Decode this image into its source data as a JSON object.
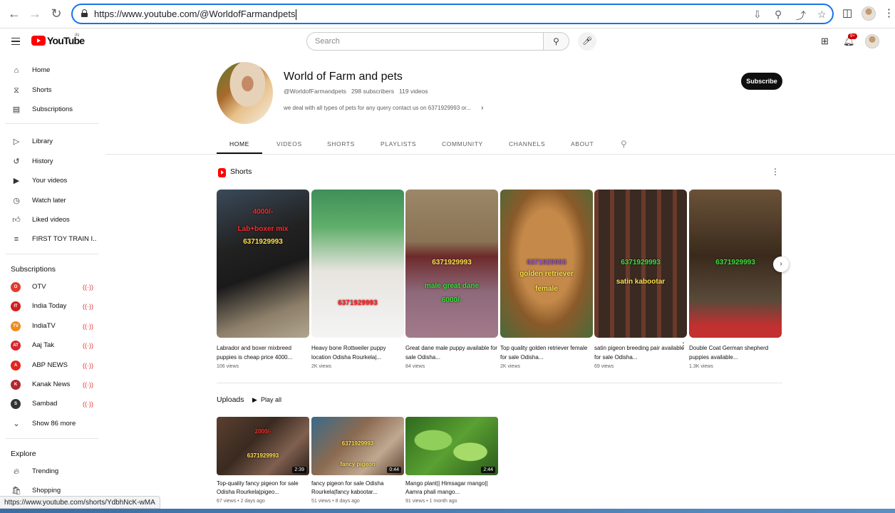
{
  "browser": {
    "url": "https://www.youtube.com/@WorldofFarmandpets",
    "status_url": "https://www.youtube.com/shorts/YdbhNcK-wMA"
  },
  "header": {
    "logo_text": "YouTube",
    "logo_region": "IN",
    "search_placeholder": "Search",
    "notification_count": "9+"
  },
  "sidebar": {
    "main": [
      {
        "label": "Home",
        "icon": "home-icon"
      },
      {
        "label": "Shorts",
        "icon": "shorts-icon"
      },
      {
        "label": "Subscriptions",
        "icon": "subscriptions-icon"
      }
    ],
    "library": [
      {
        "label": "Library",
        "icon": "library-icon"
      },
      {
        "label": "History",
        "icon": "history-icon"
      },
      {
        "label": "Your videos",
        "icon": "your-videos-icon"
      },
      {
        "label": "Watch later",
        "icon": "watch-later-icon"
      },
      {
        "label": "Liked videos",
        "icon": "liked-videos-icon"
      },
      {
        "label": "FIRST TOY TRAIN I...",
        "icon": "playlist-icon"
      }
    ],
    "subscriptions_heading": "Subscriptions",
    "subscriptions": [
      {
        "label": "OTV",
        "color": "#e23b2e",
        "abbr": "O"
      },
      {
        "label": "India Today",
        "color": "#d0201f",
        "abbr": "IT"
      },
      {
        "label": "IndiaTV",
        "color": "#f08a1c",
        "abbr": "TV"
      },
      {
        "label": "Aaj Tak",
        "color": "#d7262d",
        "abbr": "AT"
      },
      {
        "label": "ABP NEWS",
        "color": "#e1251b",
        "abbr": "A"
      },
      {
        "label": "Kanak News",
        "color": "#b3272d",
        "abbr": "K"
      },
      {
        "label": "Sambad",
        "color": "#333333",
        "abbr": "S"
      }
    ],
    "show_more": "Show 86 more",
    "explore_heading": "Explore",
    "explore": [
      {
        "label": "Trending",
        "icon": "trending-icon"
      },
      {
        "label": "Shopping",
        "icon": "shopping-icon"
      }
    ]
  },
  "channel": {
    "name": "World of Farm and pets",
    "handle": "@WorldofFarmandpets",
    "subscribers": "298 subscribers",
    "videos": "119 videos",
    "description": "we deal with all types of pets for any query contact us on 6371929993 or...",
    "subscribe_label": "Subscribe",
    "tabs": [
      "HOME",
      "VIDEOS",
      "SHORTS",
      "PLAYLISTS",
      "COMMUNITY",
      "CHANNELS",
      "ABOUT"
    ]
  },
  "shorts_section": {
    "heading": "Shorts",
    "items": [
      {
        "title": "Labrador and boxer mixbreed puppies is cheap price 4000...",
        "views": "106 views",
        "overlay": [
          "4000/-",
          "Lab+boxer mix",
          "6371929993"
        ],
        "overlay_colors": [
          "#ff2a2a",
          "#ff2a2a",
          "#ffe14a"
        ]
      },
      {
        "title": "Heavy bone Rottweiler puppy location Odisha Rourkela|...",
        "views": "2K views",
        "overlay": [
          "6371929993"
        ],
        "overlay_colors": [
          "#ff2a2a"
        ]
      },
      {
        "title": "Great dane male puppy available for sale Odisha...",
        "views": "84 views",
        "overlay": [
          "6371929993",
          "male great dane",
          "6000/-"
        ],
        "overlay_colors": [
          "#ffe14a",
          "#3be03b",
          "#3be03b"
        ]
      },
      {
        "title": "Top quality golden retriever female for sale Odisha...",
        "views": "2K views",
        "overlay": [
          "6371929993",
          "golden retriever",
          "female"
        ],
        "overlay_colors": [
          "#9b4bff",
          "#ffe14a",
          "#ffe14a"
        ]
      },
      {
        "title": "satin pigeon breeding pair available for sale Odisha...",
        "views": "69 views",
        "overlay": [
          "6371929993",
          "satin kabootar"
        ],
        "overlay_colors": [
          "#3be03b",
          "#ffe14a"
        ]
      },
      {
        "title": "Double Coat German shepherd puppies available...",
        "views": "1.3K views",
        "overlay": [
          "6371929993"
        ],
        "overlay_colors": [
          "#3be03b"
        ]
      }
    ]
  },
  "uploads_section": {
    "heading": "Uploads",
    "play_all": "Play all",
    "items": [
      {
        "title": "Top-quality fancy pigeon for sale Odisha Rourkela|pigeo...",
        "meta": "67 views • 2 days ago",
        "duration": "2:39",
        "overlay": [
          "2000/-",
          "6371929993"
        ],
        "overlay_colors": [
          "#ff2a2a",
          "#ffe14a"
        ]
      },
      {
        "title": "fancy pigeon for sale Odisha Rourkela|fancy kabootar...",
        "meta": "51 views • 8 days ago",
        "duration": "0:44",
        "overlay": [
          "6371929993",
          "fancy pigeon"
        ],
        "overlay_colors": [
          "#ffe14a",
          "#ffe14a"
        ]
      },
      {
        "title": "Mango plant|| Himsagar mango|| Aamra phali mango...",
        "meta": "91 views • 1 month ago",
        "duration": "2:44",
        "overlay": [],
        "overlay_colors": []
      }
    ]
  }
}
